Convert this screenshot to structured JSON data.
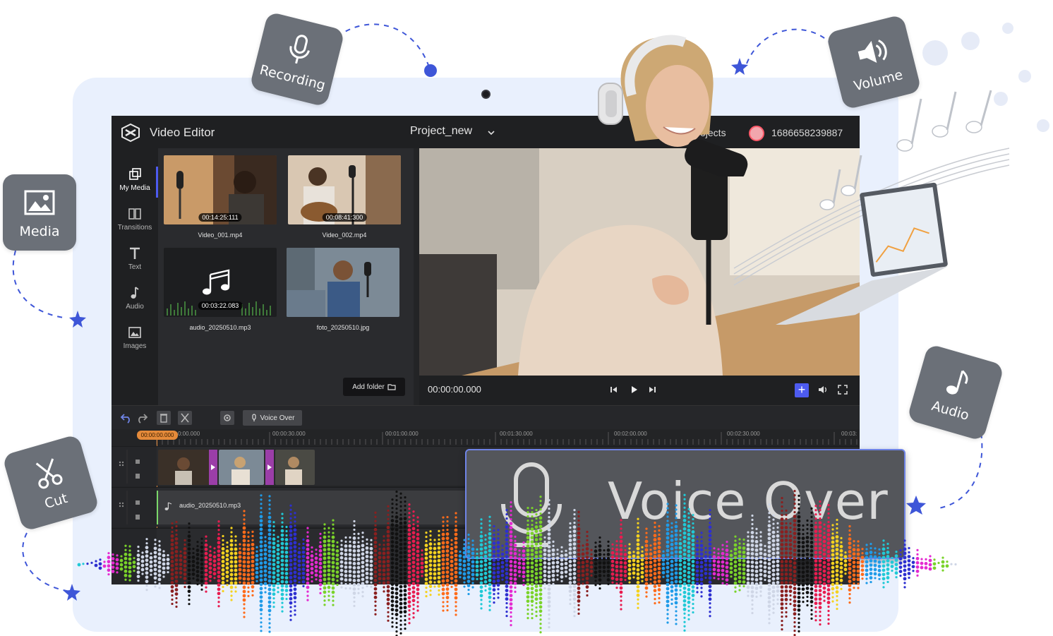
{
  "colors": {
    "backdrop": "#e9f0fd",
    "tile": "#6b7078",
    "accent": "#4d5bf0",
    "dashed": "#3e56d8",
    "star": "#3e56d8",
    "playhead": "#e48a3a",
    "transition": "#9b3ea8"
  },
  "badges": [
    {
      "label": "Recording",
      "icon": "microphone-icon"
    },
    {
      "label": "Volume",
      "icon": "speaker-icon"
    },
    {
      "label": "Media",
      "icon": "image-icon"
    },
    {
      "label": "Audio",
      "icon": "music-note-icon"
    },
    {
      "label": "Cut",
      "icon": "scissors-icon"
    }
  ],
  "app": {
    "title": "Video Editor",
    "project": "Project_new",
    "projects_link": "Projects",
    "user_id": "1686658239887"
  },
  "nav": [
    {
      "label": "My Media",
      "icon": "my-media-icon",
      "active": true
    },
    {
      "label": "Transitions",
      "icon": "transitions-icon"
    },
    {
      "label": "Text",
      "icon": "text-icon"
    },
    {
      "label": "Audio",
      "icon": "audio-icon"
    },
    {
      "label": "Images",
      "icon": "images-icon"
    }
  ],
  "media": [
    {
      "name": "Video_001.mp4",
      "duration": "00:14:25:111"
    },
    {
      "name": "Video_002.mp4",
      "duration": "00:08:41:300"
    },
    {
      "name": "audio_20250510.mp3",
      "duration": "00:03:22.083"
    },
    {
      "name": "foto_20250510.jpg",
      "duration": ""
    }
  ],
  "add_folder": "Add folder",
  "player": {
    "timecode": "00:00:00.000"
  },
  "timeline": {
    "voice_over_button": "Voice Over",
    "playhead": "00:00:00.000",
    "ruler": [
      "0:00.000",
      "00:00:30.000",
      "00:01:00.000",
      "00:01:30.000",
      "00:02:00.000",
      "00:02:30.000",
      "00:03:"
    ],
    "audio_clip": "audio_20250510.mp3"
  },
  "overlay": {
    "voice_over": "Voice Over"
  }
}
